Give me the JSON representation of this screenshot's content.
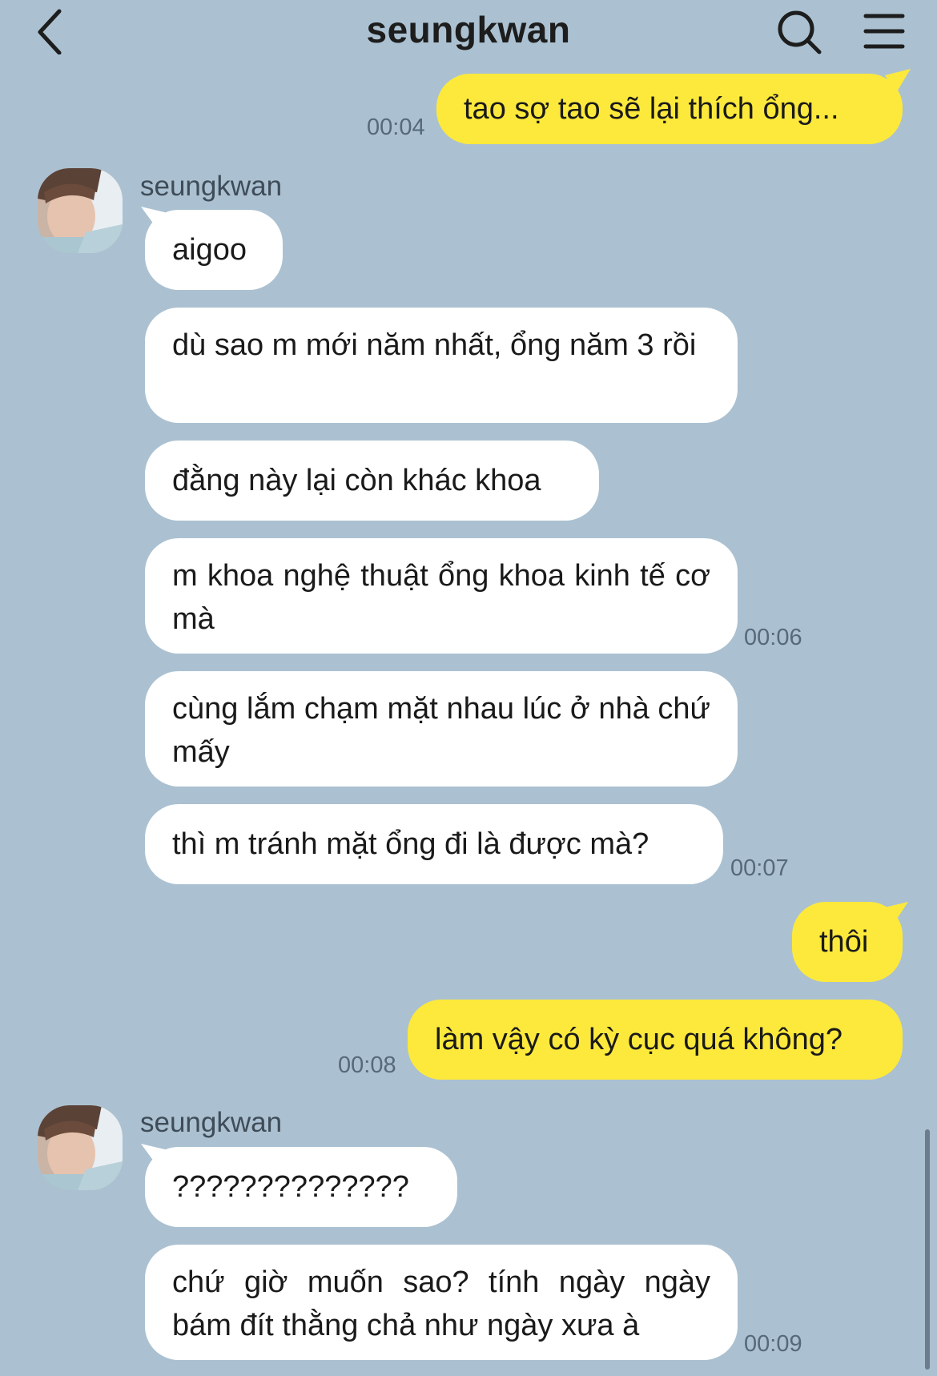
{
  "header": {
    "title": "seungkwan",
    "back_icon": "chevron-left-icon",
    "search_icon": "search-icon",
    "menu_icon": "menu-icon"
  },
  "colors": {
    "background": "#abc1d1",
    "my_bubble": "#fde93b",
    "their_bubble": "#ffffff"
  },
  "messages": [
    {
      "sender": "me",
      "text": "tao sợ tao sẽ lại thích ổng...",
      "time": "00:04"
    },
    {
      "sender": "seungkwan",
      "name": "seungkwan",
      "text": "aigoo"
    },
    {
      "sender": "seungkwan",
      "text": "dù sao m mới năm nhất, ổng năm 3 rồi"
    },
    {
      "sender": "seungkwan",
      "text": "đằng này lại còn khác khoa"
    },
    {
      "sender": "seungkwan",
      "text": "m khoa nghệ thuật ổng khoa kinh tế cơ mà",
      "time": "00:06"
    },
    {
      "sender": "seungkwan",
      "text": "cùng lắm chạm mặt nhau lúc ở nhà chứ mấy"
    },
    {
      "sender": "seungkwan",
      "text": "thì m tránh mặt ổng đi là được mà?",
      "time": "00:07"
    },
    {
      "sender": "me",
      "text": "thôi"
    },
    {
      "sender": "me",
      "text": "làm vậy có kỳ cục quá không?",
      "time": "00:08"
    },
    {
      "sender": "seungkwan",
      "name": "seungkwan",
      "text": "??????????????"
    },
    {
      "sender": "seungkwan",
      "text": "chứ giờ muốn sao? tính ngày ngày bám đít thằng chả như ngày xưa à",
      "time": "00:09"
    }
  ]
}
